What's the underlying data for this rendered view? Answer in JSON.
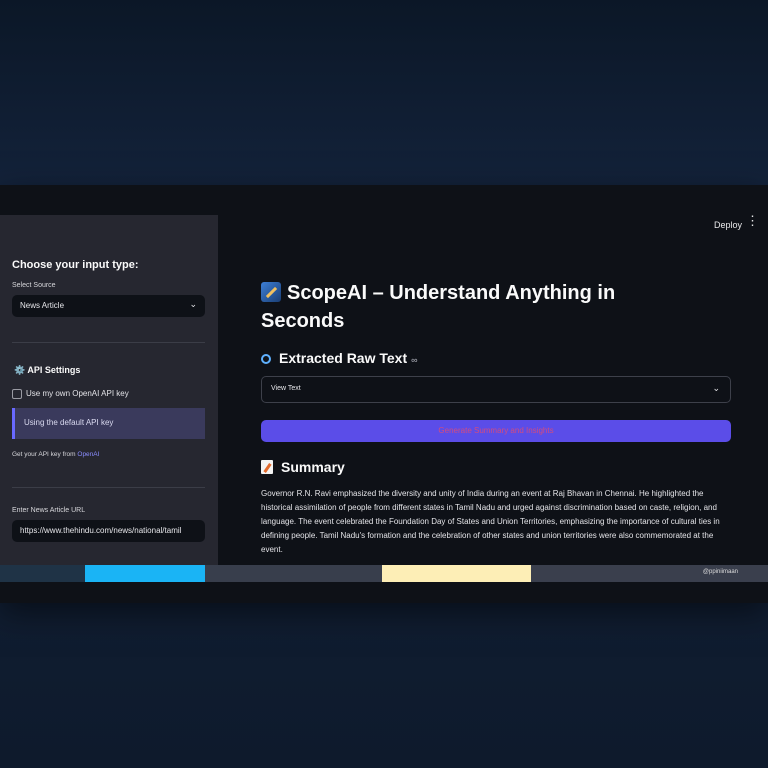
{
  "header": {
    "deploy_label": "Deploy",
    "menu_icon": "kebab-menu-icon"
  },
  "sidebar": {
    "heading": "Choose your input type:",
    "select_label": "Select Source",
    "select_value": "News Article",
    "api_settings_title": "⚙️ API Settings",
    "checkbox_label": "Use my own OpenAI API key",
    "info_text": "Using the default API key",
    "get_key_prefix": "Get your API key from",
    "get_key_link": "OpenAI",
    "url_label": "Enter News Article URL",
    "url_value": "https://www.thehindu.com/news/national/tamil"
  },
  "main": {
    "title": "ScopeAI – Understand Anything in Seconds",
    "raw_text_heading": "Extracted Raw Text",
    "link_icon": "∞",
    "expander_label": "View Text",
    "generate_button": "Generate Summary and Insights",
    "summary_heading": "Summary",
    "summary_text": "Governor R.N. Ravi emphasized the diversity and unity of India during an event at Raj Bhavan in Chennai. He highlighted the historical assimilation of people from different states in Tamil Nadu and urged against discrimination based on caste, religion, and language. The event celebrated the Foundation Day of States and Union Territories, emphasizing the importance of cultural ties in defining people. Tamil Nadu's formation and the celebration of other states and union territories were also commemorated at the event."
  },
  "bottom_bar": {
    "text": "@ppiniimaan"
  },
  "colors": {
    "sidebar_bg": "#262730",
    "main_bg": "#0e1117",
    "button_bg": "#5b4de8",
    "button_text": "#d34c7e",
    "info_bg": "#3a3a5c",
    "accent_blue": "#1ab4f5",
    "accent_cream": "#fdeeb6"
  }
}
